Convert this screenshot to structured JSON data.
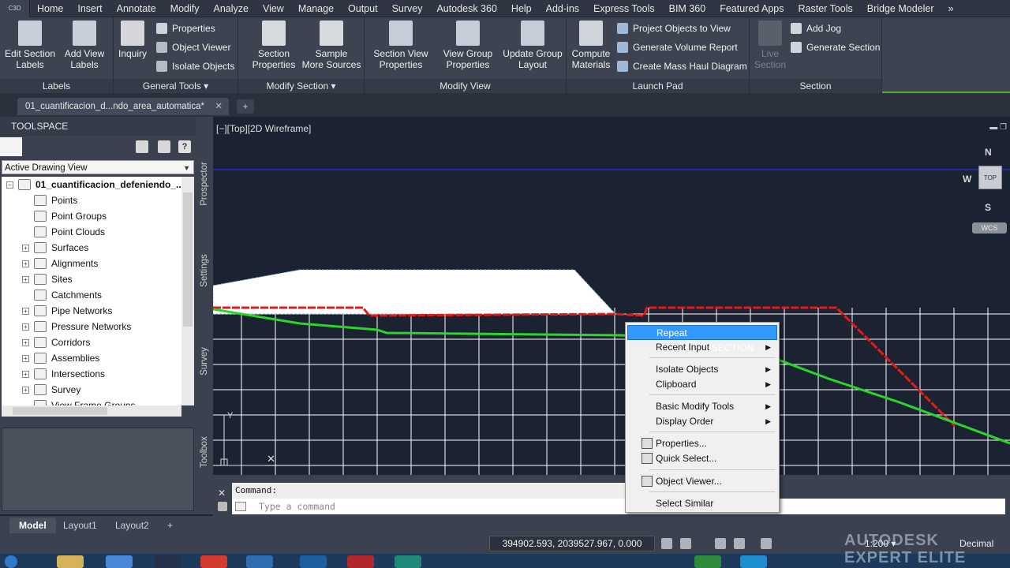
{
  "app": {
    "logo": "C3D"
  },
  "menubar": {
    "items": [
      "Home",
      "Insert",
      "Annotate",
      "Modify",
      "Analyze",
      "View",
      "Manage",
      "Output",
      "Survey",
      "Autodesk 360",
      "Help",
      "Add-ins",
      "Express Tools",
      "BIM 360",
      "Featured Apps",
      "Raster Tools",
      "Bridge Modeler"
    ],
    "more": "»"
  },
  "ribbon": {
    "panels": {
      "labels": {
        "title": "Labels",
        "btn1": "Edit Section\nLabels",
        "btn2": "Add View\nLabels"
      },
      "general": {
        "title": "General Tools ▾",
        "inquiry": "Inquiry",
        "properties": "Properties",
        "object_viewer": "Object Viewer",
        "isolate": "Isolate Objects"
      },
      "modify_section": {
        "title": "Modify Section ▾",
        "section_props": "Section\nProperties",
        "sample": "Sample\nMore Sources"
      },
      "modify_view": {
        "title": "Modify View",
        "sv_props": "Section View\nProperties",
        "vg_props": "View Group\nProperties",
        "update_group": "Update Group\nLayout"
      },
      "launch_pad": {
        "title": "Launch Pad",
        "compute": "Compute\nMaterials",
        "project": "Project Objects to View",
        "volume": "Generate Volume Report",
        "mass_haul": "Create Mass Haul Diagram"
      },
      "section": {
        "title": "Section",
        "live": "Live\nSection",
        "add_jog": "Add Jog",
        "generate": "Generate Section"
      }
    }
  },
  "doc_tabs": {
    "active": "01_cuantificacion_d...ndo_area_automatica*",
    "close": "✕",
    "new": "+"
  },
  "toolspace": {
    "title": "TOOLSPACE",
    "view_select": "Active Drawing View",
    "root": "01_cuantificacion_defeniendo_...",
    "nodes": [
      "Points",
      "Point Groups",
      "Point Clouds",
      "Surfaces",
      "Alignments",
      "Sites",
      "Catchments",
      "Pipe Networks",
      "Pressure Networks",
      "Corridors",
      "Assemblies",
      "Intersections",
      "Survey",
      "View Frame Groups"
    ],
    "expandable": [
      false,
      false,
      false,
      true,
      true,
      true,
      false,
      true,
      true,
      true,
      true,
      true,
      true,
      false
    ]
  },
  "vtabs": [
    "Prospector",
    "Settings",
    "Survey",
    "Toolbox"
  ],
  "viewport": {
    "label": "[−][Top][2D Wireframe]",
    "compass": {
      "n": "N",
      "s": "S",
      "w": "W",
      "cube": "TOP",
      "wcs": "WCS"
    },
    "controls": "▬ ❐"
  },
  "context_menu": {
    "items": [
      {
        "label": "Repeat EDITCROSSSECTION",
        "highlight": true,
        "sub": false
      },
      {
        "label": "Recent Input",
        "highlight": false,
        "sub": true
      },
      {
        "label": "Isolate Objects",
        "highlight": false,
        "sub": true
      },
      {
        "label": "Clipboard",
        "highlight": false,
        "sub": true
      },
      {
        "label": "Basic Modify Tools",
        "highlight": false,
        "sub": true
      },
      {
        "label": "Display Order",
        "highlight": false,
        "sub": true
      },
      {
        "label": "Properties...",
        "highlight": false,
        "sub": false
      },
      {
        "label": "Quick Select...",
        "highlight": false,
        "sub": false
      },
      {
        "label": "Object Viewer...",
        "highlight": false,
        "sub": false
      },
      {
        "label": "Select Similar",
        "highlight": false,
        "sub": false
      }
    ],
    "submenu_arrow": "▶"
  },
  "command": {
    "history": "Command:",
    "placeholder": "Type a command",
    "close": "✕"
  },
  "layout_tabs": [
    "Model",
    "Layout1",
    "Layout2"
  ],
  "layout_add": "+",
  "status": {
    "coords": "394902.593, 2039527.967, 0.000",
    "scale": "1:200 ▾",
    "units": "Decimal"
  },
  "watermark": {
    "line1": "AUTODESK",
    "line2": "EXPERT ELITE"
  },
  "colors": {
    "accent_green": "#5ea83a",
    "highlight": "#3399ff",
    "grid": "#ffffff",
    "red_profile": "#e01b1b",
    "green_profile": "#2bd62b",
    "blue_line": "#2b2bd6"
  }
}
